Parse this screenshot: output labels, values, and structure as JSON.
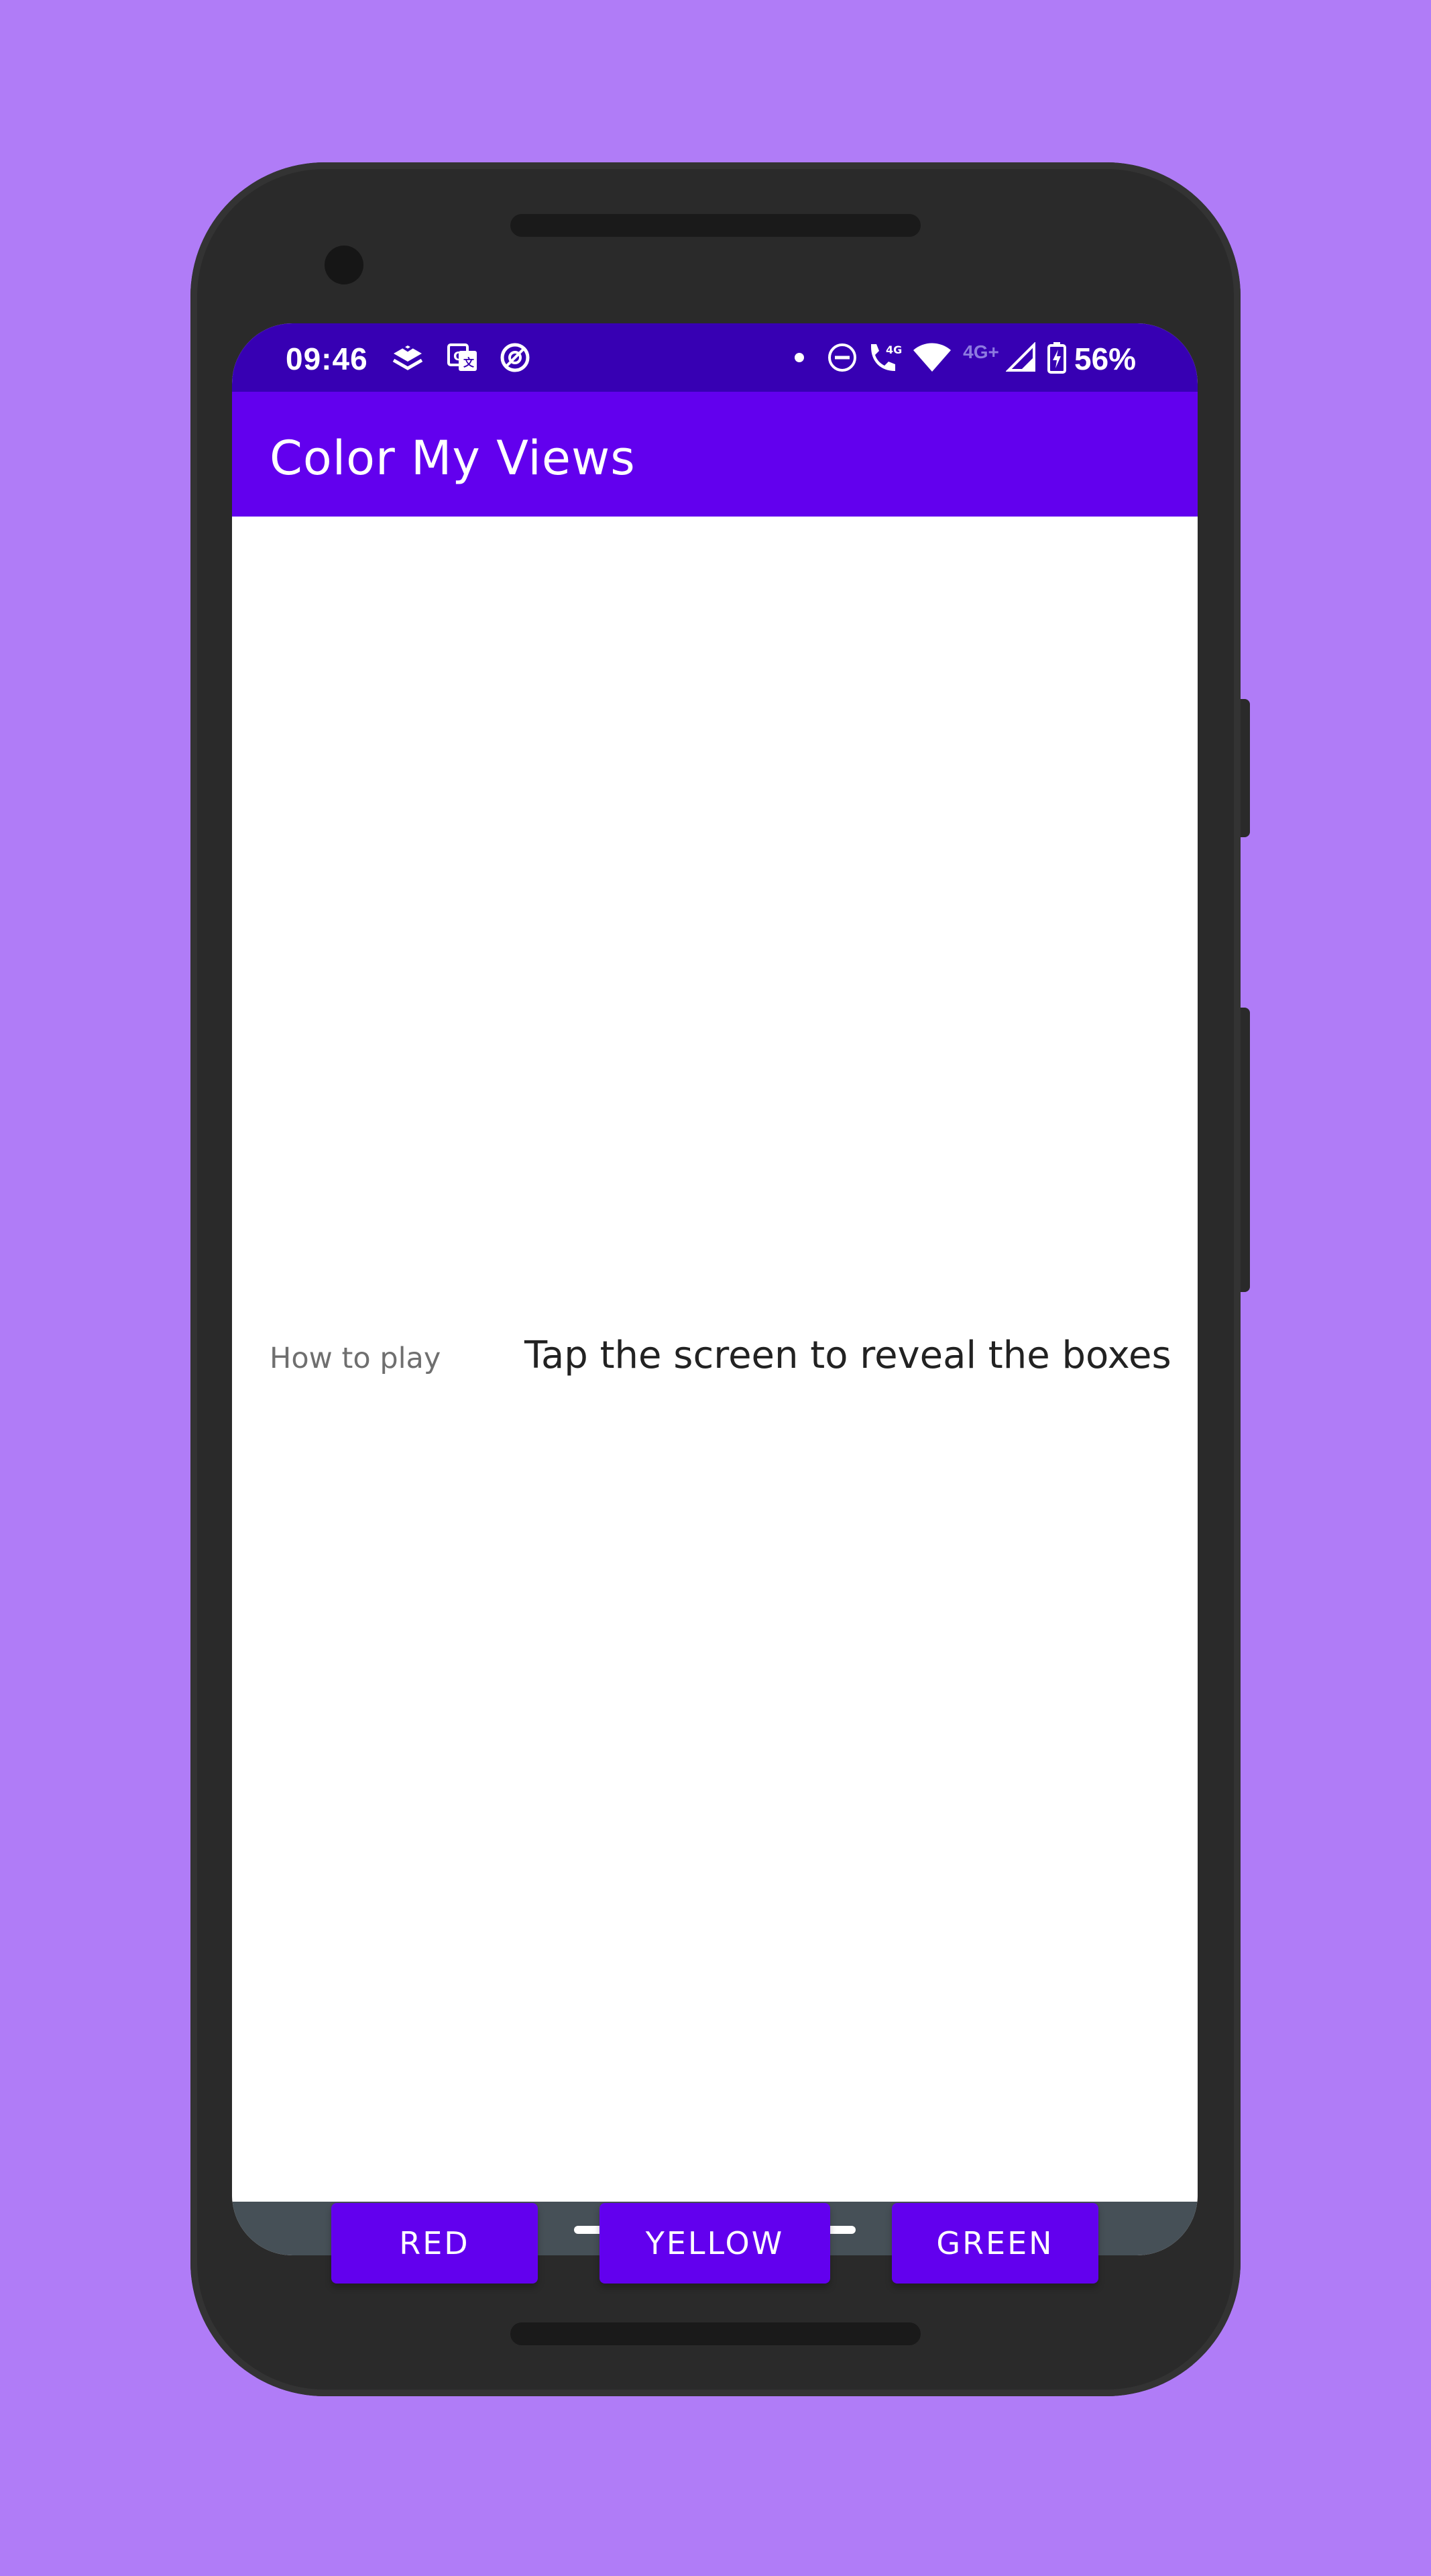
{
  "status_bar": {
    "time": "09:46",
    "battery": "56%",
    "icons": [
      "layers-icon",
      "translate-icon",
      "data-saver-icon",
      "dot-icon",
      "do-not-disturb-icon",
      "wifi-call-icon",
      "wifi-icon",
      "signal-icon",
      "battery-charging-icon"
    ],
    "volte_label": "4G",
    "network_label": "4G+"
  },
  "app_bar": {
    "title": "Color My Views"
  },
  "content": {
    "label_text": "How to play",
    "info_text": "Tap the screen to reveal the boxes"
  },
  "buttons": {
    "red": "RED",
    "yellow": "YELLOW",
    "green": "GREEN"
  },
  "colors": {
    "background": "#b07cf7",
    "status_bar": "#3700b3",
    "primary": "#6200ee",
    "nav_bar": "#465057"
  }
}
